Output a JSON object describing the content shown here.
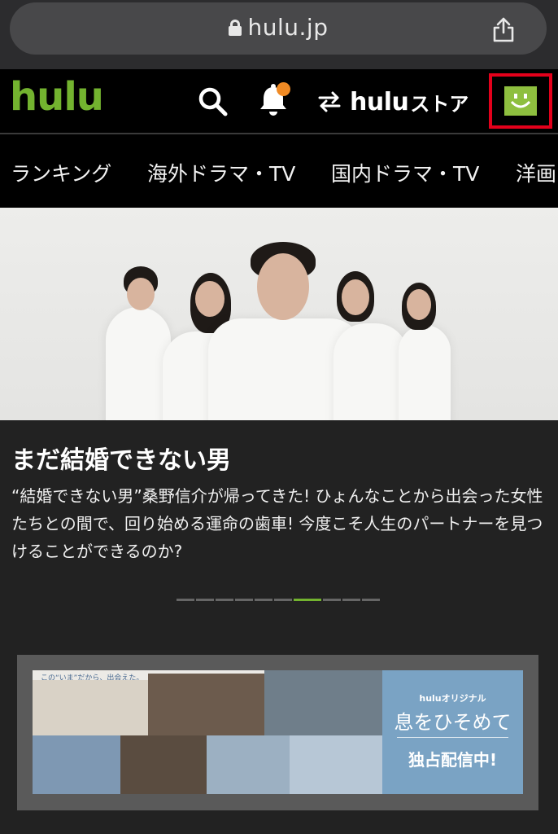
{
  "browser": {
    "url": "hulu.jp"
  },
  "header": {
    "logo": "hulu",
    "store_brand": "hulu",
    "store_suffix": "ストア",
    "icons": [
      "search-icon",
      "bell-icon",
      "swap-arrows-icon",
      "avatar-smiley-icon",
      "share-icon",
      "lock-icon"
    ],
    "notification_dot_color": "#f08a24",
    "accent_color": "#73b32f",
    "highlight_color": "#e3001b"
  },
  "nav": {
    "items": [
      {
        "label": "ランキング"
      },
      {
        "label": "海外ドラマ・TV"
      },
      {
        "label": "国内ドラマ・TV"
      },
      {
        "label": "洋画"
      }
    ]
  },
  "hero": {
    "title": "まだ結婚できない男",
    "description": "“結婚できない男”桑野信介が帰ってきた! ひょんなことから出会った女性たちとの間で、回り始める運命の歯車! 今度こそ人生のパートナーを見つけることができるのか?",
    "pager": {
      "total": 10,
      "active_index": 6
    }
  },
  "banner": {
    "tagline": "この“いま”だから、出会えた。",
    "brand": "huluオリジナル",
    "title": "息をひそめて",
    "cta": "独占配信中!"
  }
}
